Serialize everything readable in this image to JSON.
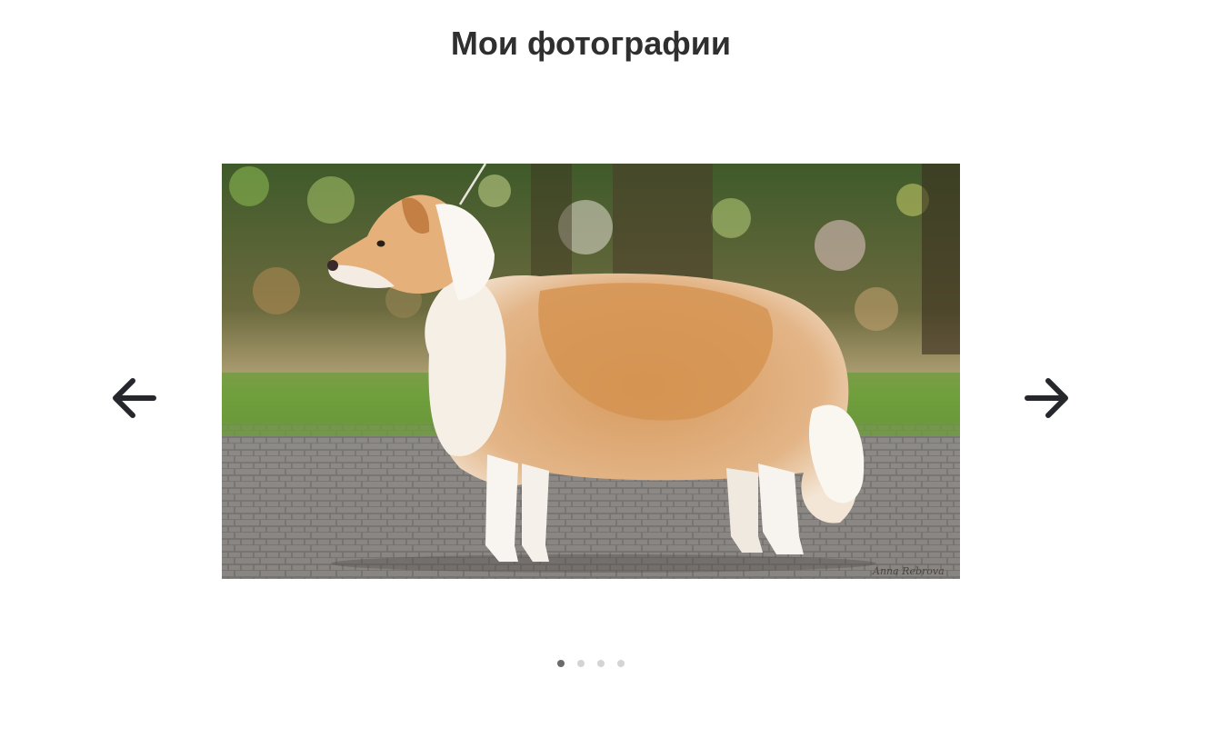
{
  "header": {
    "title": "Мои фотографии"
  },
  "carousel": {
    "prev_icon": "arrow-left-icon",
    "next_icon": "arrow-right-icon",
    "slide_count": 4,
    "active_slide": 1,
    "current_slide": {
      "subject": "dog",
      "watermark": "Anna Rebrova"
    }
  },
  "colors": {
    "title": "#2f2f2f",
    "arrow": "#25272c",
    "dot_active": "#6b6b6b",
    "dot_inactive": "#d4d4d4"
  }
}
